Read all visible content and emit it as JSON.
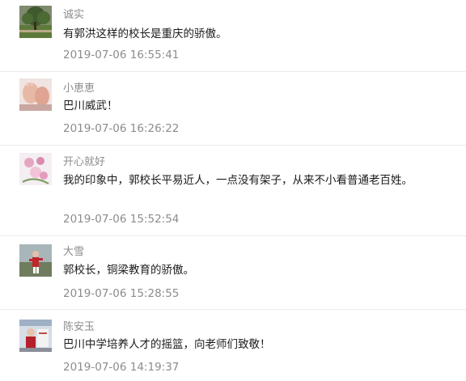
{
  "comments": [
    {
      "nickname": "诚实",
      "content": "有郭洪这样的校长是重庆的骄傲。",
      "time": "2019-07-06 16:55:41",
      "avatar": "tree-landscape-avatar"
    },
    {
      "nickname": "小恵恵",
      "content": "巴川威武！",
      "time": "2019-07-06 16:26:22",
      "avatar": "baby-feet-avatar"
    },
    {
      "nickname": "开心就好",
      "content": "我的印象中，郭校长平易近人，一点没有架子，从来不小看普通老百姓。",
      "time": "2019-07-06 15:52:54",
      "avatar": "flowers-avatar"
    },
    {
      "nickname": "大雪",
      "content": "郭校长，铜梁教育的骄傲。",
      "time": "2019-07-06 15:28:55",
      "avatar": "person-outdoors-avatar"
    },
    {
      "nickname": "陈安玉",
      "content": "巴川中学培养人才的摇篮，向老师们致敬！",
      "time": "2019-07-06 14:19:37",
      "avatar": "person-red-avatar"
    }
  ]
}
